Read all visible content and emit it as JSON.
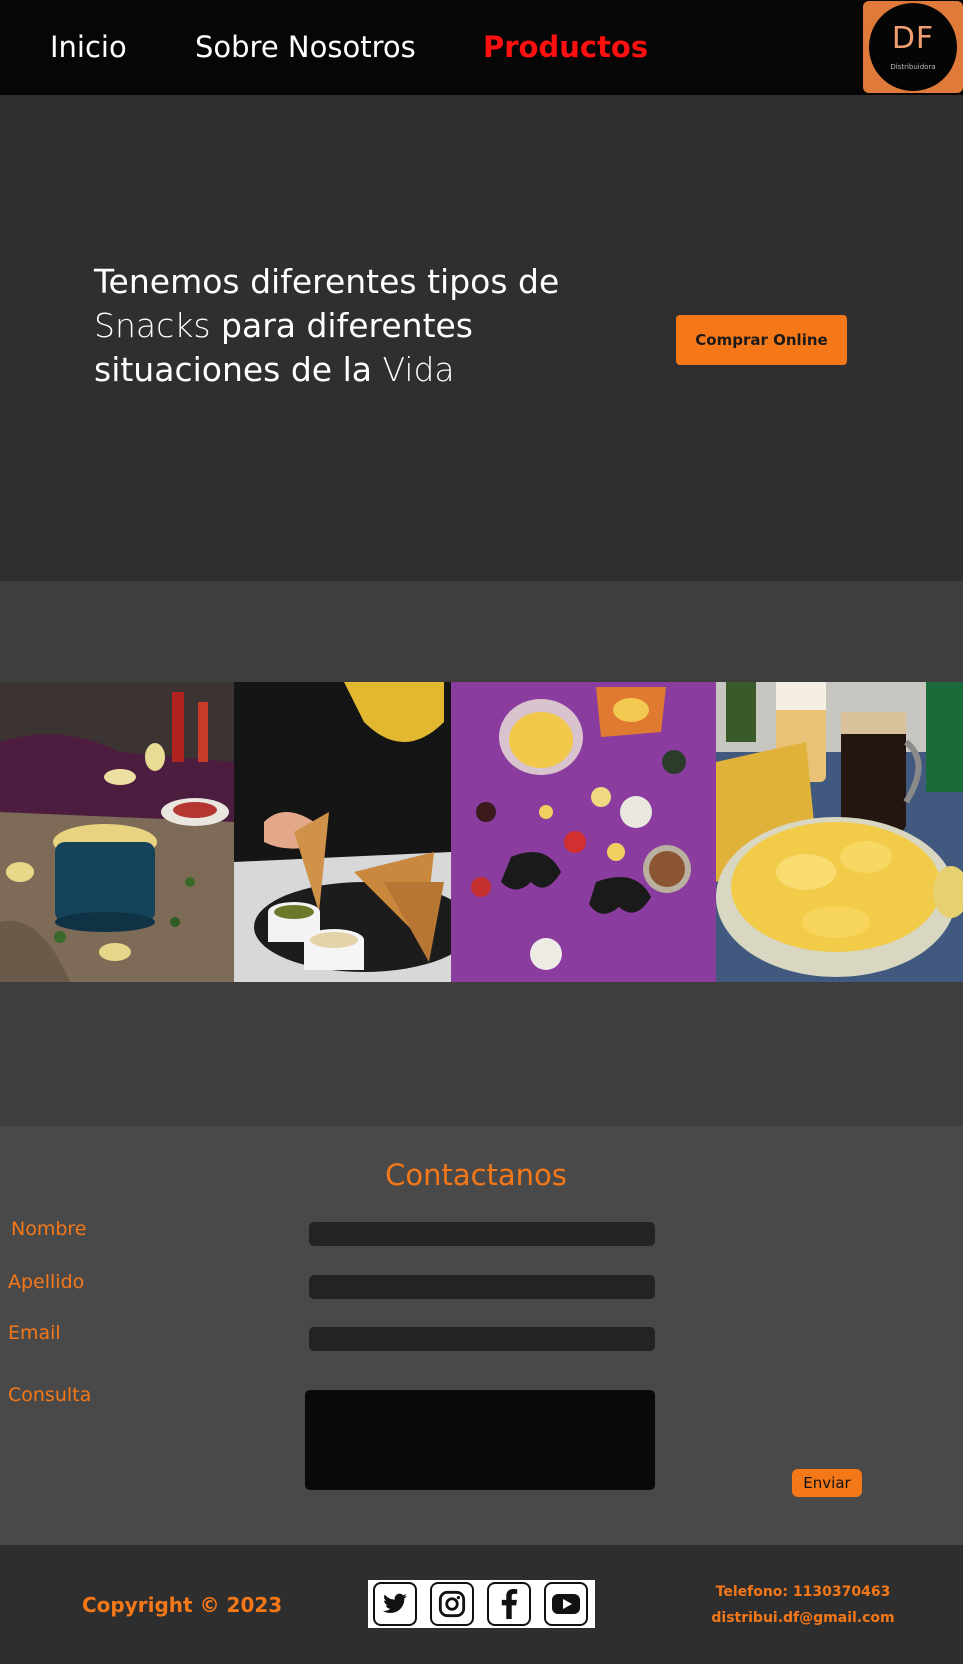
{
  "nav": {
    "items": [
      {
        "label": "Inicio"
      },
      {
        "label": "Sobre Nosotros"
      },
      {
        "label": "Productos"
      }
    ],
    "logo_letters": "DF",
    "logo_sub": "Distribuidora"
  },
  "hero": {
    "title_part1": "Tenemos diferentes tipos de",
    "title_part2": "Snacks",
    "title_part3": " para diferentes situaciones de la ",
    "title_part4": "Vida",
    "button_label": "Comprar Online"
  },
  "contact": {
    "title": "Contactanos",
    "fields": [
      {
        "label": "Nombre"
      },
      {
        "label": "Apellido"
      },
      {
        "label": "Email"
      },
      {
        "label": "Consulta"
      }
    ],
    "submit_label": "Enviar"
  },
  "footer": {
    "copyright": "Copyright © 2023",
    "socials": [
      "twitter-icon",
      "instagram-icon",
      "facebook-icon",
      "youtube-icon"
    ],
    "phone": "Telefono: 1130370463",
    "email": "distribui.df@gmail.com"
  },
  "colors": {
    "accent": "#f57818",
    "active_nav": "#ff0f0f",
    "nav_bg": "#060606",
    "hero_bg": "#302e2f"
  }
}
